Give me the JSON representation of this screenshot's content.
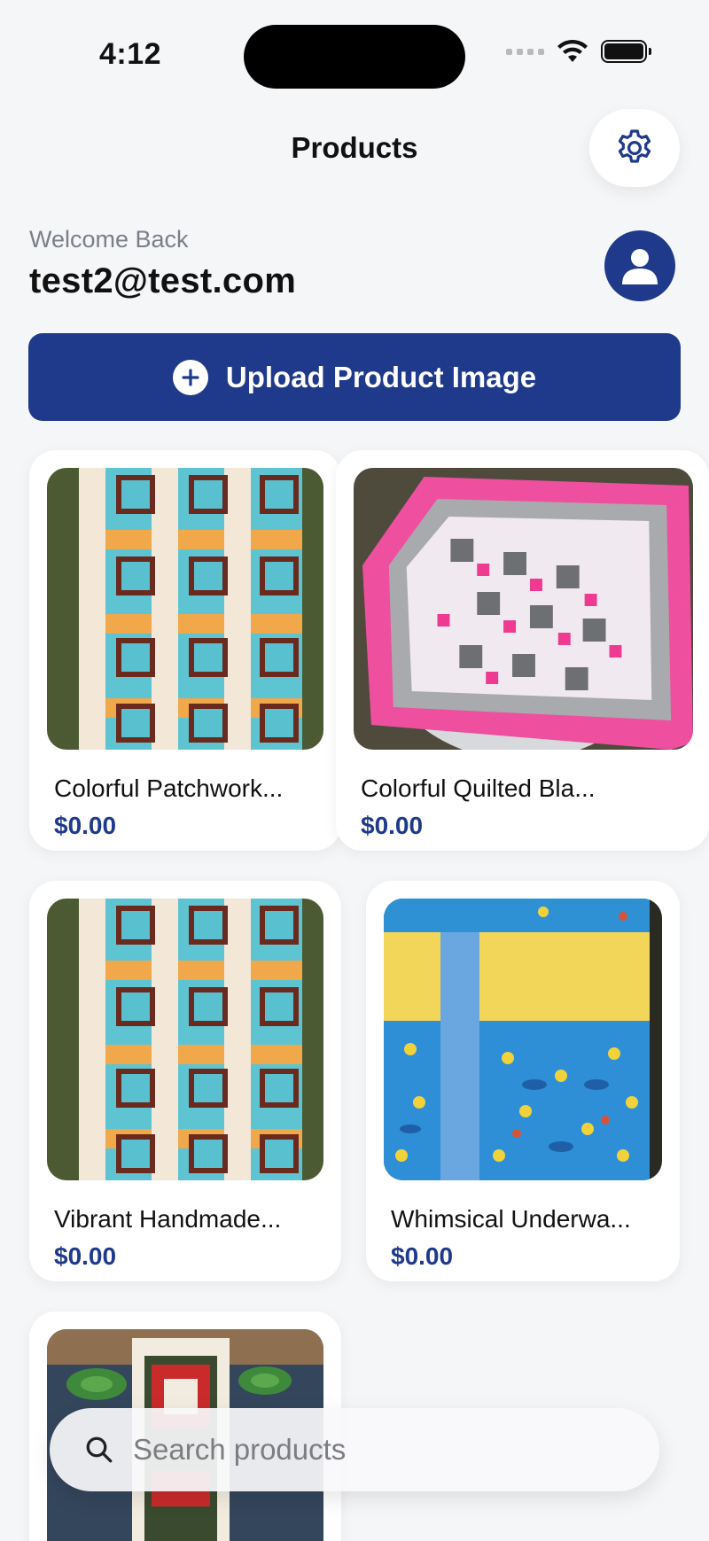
{
  "status_bar": {
    "time": "4:12"
  },
  "nav": {
    "title": "Products",
    "settings_icon": "gear-icon"
  },
  "user": {
    "greeting": "Welcome Back",
    "email": "test2@test.com",
    "avatar_icon": "person-icon"
  },
  "upload": {
    "label": "Upload Product Image",
    "icon": "plus-circle-icon"
  },
  "products": [
    {
      "name": "Colorful Patchwork...",
      "price": "$0.00"
    },
    {
      "name": "Colorful Quilted Bla...",
      "price": "$0.00"
    },
    {
      "name": "Vibrant Handmade...",
      "price": "$0.00"
    },
    {
      "name": "Whimsical Underwa...",
      "price": "$0.00"
    },
    {
      "name": "",
      "price": ""
    }
  ],
  "search": {
    "placeholder": "Search products",
    "icon": "search-icon"
  },
  "colors": {
    "accent": "#1f3a8a",
    "background": "#f5f6f8",
    "card": "#ffffff"
  }
}
